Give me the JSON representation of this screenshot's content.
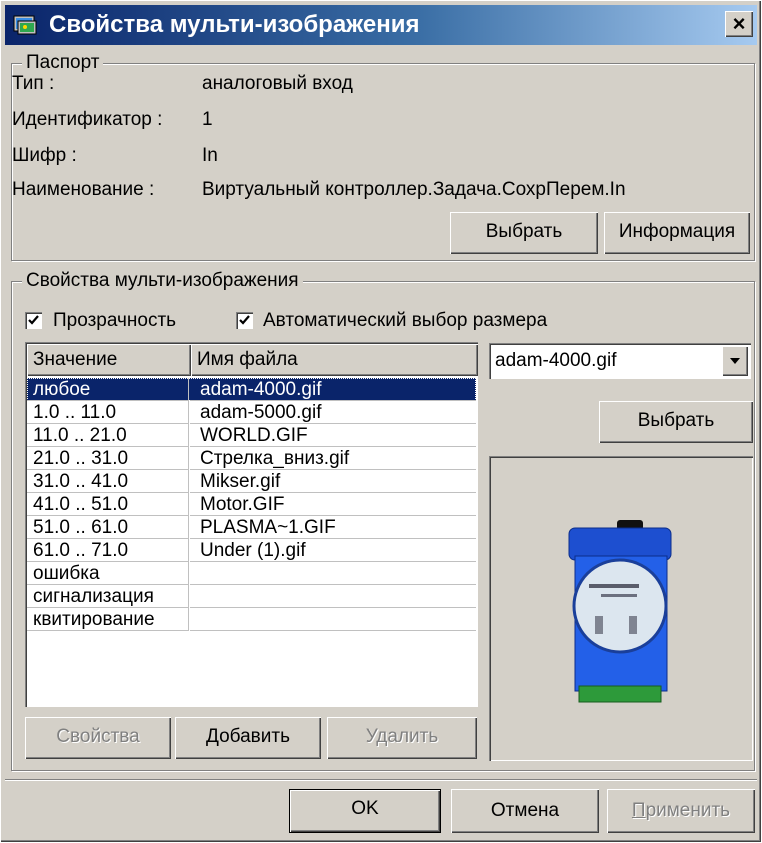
{
  "window": {
    "title": "Свойства мульти-изображения",
    "close_label": "×",
    "title_color": "#0a246a"
  },
  "passport": {
    "legend": "Паспорт",
    "fields": [
      {
        "label": "Тип :",
        "value": "аналоговый вход"
      },
      {
        "label": "Идентификатор :",
        "value": "1"
      },
      {
        "label": "Шифр :",
        "value": "In"
      },
      {
        "label": "Наименование :",
        "value": "Виртуальный контроллер.Задача.СохрПерем.In"
      }
    ],
    "select_button": "Выбрать",
    "info_button": "Информация"
  },
  "properties": {
    "legend": "Свойства мульти-изображения",
    "transparency": {
      "label": "Прозрачность",
      "checked": true
    },
    "autosize": {
      "label": "Автоматический выбор размера",
      "checked": true
    },
    "table": {
      "columns": [
        "Значение",
        "Имя файла"
      ],
      "rows": [
        {
          "value": "любое",
          "file": "adam-4000.gif",
          "selected": true
        },
        {
          "value": "1.0 .. 11.0",
          "file": "adam-5000.gif"
        },
        {
          "value": "11.0 .. 21.0",
          "file": "WORLD.GIF"
        },
        {
          "value": "21.0 .. 31.0",
          "file": "Стрелка_вниз.gif"
        },
        {
          "value": "31.0 .. 41.0",
          "file": "Mikser.gif"
        },
        {
          "value": "41.0 .. 51.0",
          "file": "Motor.GIF"
        },
        {
          "value": "51.0 .. 61.0",
          "file": "PLASMA~1.GIF"
        },
        {
          "value": "61.0 .. 71.0",
          "file": "Under (1).gif"
        },
        {
          "value": "ошибка",
          "file": ""
        },
        {
          "value": "сигнализация",
          "file": ""
        },
        {
          "value": "квитирование",
          "file": ""
        }
      ]
    },
    "file_select": {
      "value": "adam-4000.gif"
    },
    "file_select_button": "Выбрать",
    "preview_icon": "adam-module-image",
    "buttons": {
      "properties": "Свойства",
      "add": "Добавить",
      "delete": "Удалить"
    }
  },
  "footer": {
    "ok": "OK",
    "cancel": "Отмена",
    "apply": "Применить"
  }
}
